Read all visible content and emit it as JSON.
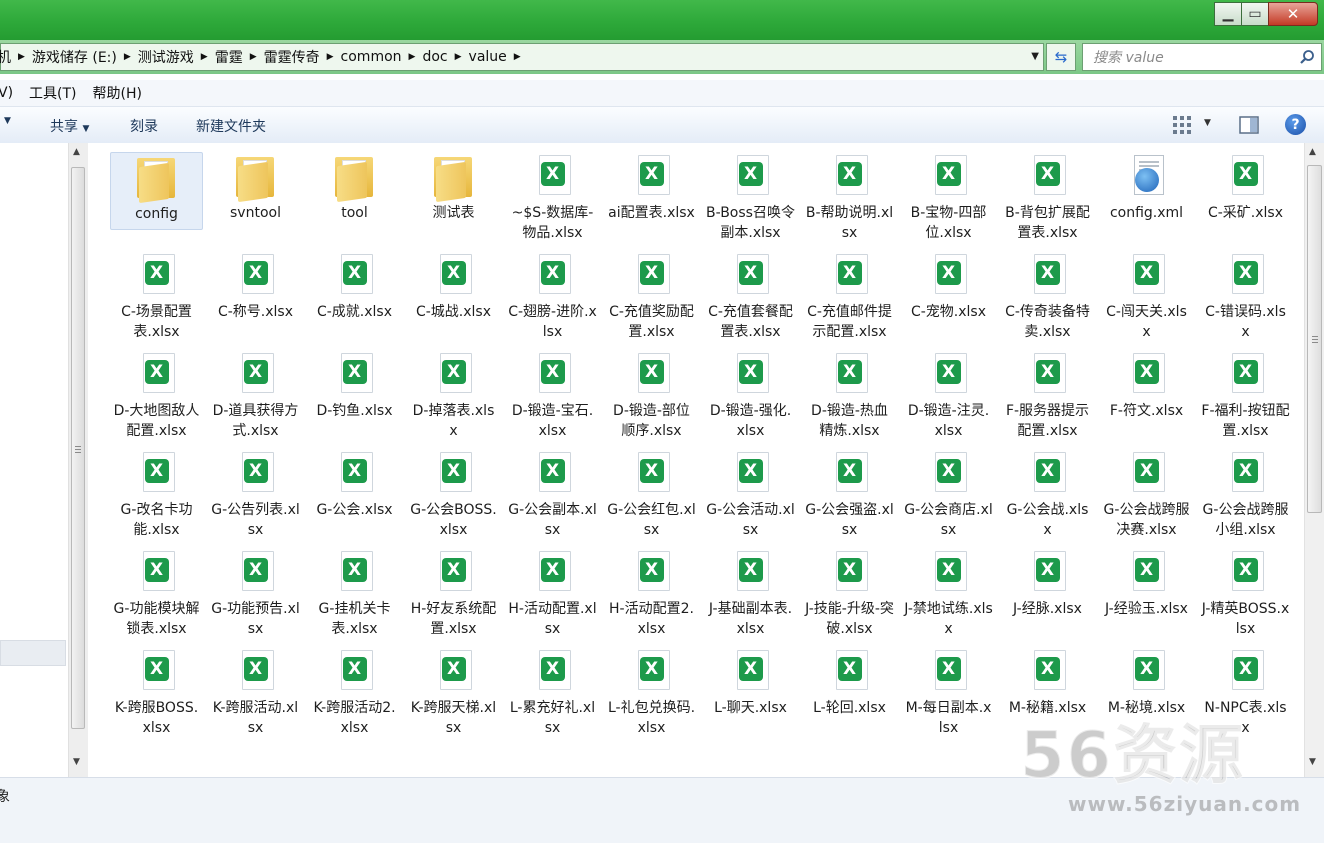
{
  "address": {
    "crumbs": [
      "机",
      "游戏储存 (E:)",
      "测试游戏",
      "雷霆",
      "雷霆传奇",
      "common",
      "doc",
      "value"
    ]
  },
  "search": {
    "placeholder": "搜索 value"
  },
  "menu": {
    "items": [
      "V)",
      "工具(T)",
      "帮助(H)"
    ]
  },
  "toolbar": {
    "share_label": "共享",
    "burn_label": "刻录",
    "new_folder_label": "新建文件夹"
  },
  "help": {
    "label": "?"
  },
  "files": [
    {
      "name": "config",
      "type": "folder"
    },
    {
      "name": "svntool",
      "type": "folder"
    },
    {
      "name": "tool",
      "type": "folder"
    },
    {
      "name": "测试表",
      "type": "folder"
    },
    {
      "name": "~$S-数据库-物品.xlsx",
      "type": "xlsx"
    },
    {
      "name": "ai配置表.xlsx",
      "type": "xlsx"
    },
    {
      "name": "B-Boss召唤令副本.xlsx",
      "type": "xlsx"
    },
    {
      "name": "B-帮助说明.xlsx",
      "type": "xlsx"
    },
    {
      "name": "B-宝物-四部位.xlsx",
      "type": "xlsx"
    },
    {
      "name": "B-背包扩展配置表.xlsx",
      "type": "xlsx"
    },
    {
      "name": "config.xml",
      "type": "xml"
    },
    {
      "name": "C-采矿.xlsx",
      "type": "xlsx"
    },
    {
      "name": "C-场景配置表.xlsx",
      "type": "xlsx"
    },
    {
      "name": "C-称号.xlsx",
      "type": "xlsx"
    },
    {
      "name": "C-成就.xlsx",
      "type": "xlsx"
    },
    {
      "name": "C-城战.xlsx",
      "type": "xlsx"
    },
    {
      "name": "C-翅膀-进阶.xlsx",
      "type": "xlsx"
    },
    {
      "name": "C-充值奖励配置.xlsx",
      "type": "xlsx"
    },
    {
      "name": "C-充值套餐配置表.xlsx",
      "type": "xlsx"
    },
    {
      "name": "C-充值邮件提示配置.xlsx",
      "type": "xlsx"
    },
    {
      "name": "C-宠物.xlsx",
      "type": "xlsx"
    },
    {
      "name": "C-传奇装备特卖.xlsx",
      "type": "xlsx"
    },
    {
      "name": "C-闯天关.xlsx",
      "type": "xlsx"
    },
    {
      "name": "C-错误码.xlsx",
      "type": "xlsx"
    },
    {
      "name": "D-大地图敌人配置.xlsx",
      "type": "xlsx"
    },
    {
      "name": "D-道具获得方式.xlsx",
      "type": "xlsx"
    },
    {
      "name": "D-钓鱼.xlsx",
      "type": "xlsx"
    },
    {
      "name": "D-掉落表.xlsx",
      "type": "xlsx"
    },
    {
      "name": "D-锻造-宝石.xlsx",
      "type": "xlsx"
    },
    {
      "name": "D-锻造-部位顺序.xlsx",
      "type": "xlsx"
    },
    {
      "name": "D-锻造-强化.xlsx",
      "type": "xlsx"
    },
    {
      "name": "D-锻造-热血精炼.xlsx",
      "type": "xlsx"
    },
    {
      "name": "D-锻造-注灵.xlsx",
      "type": "xlsx"
    },
    {
      "name": "F-服务器提示配置.xlsx",
      "type": "xlsx"
    },
    {
      "name": "F-符文.xlsx",
      "type": "xlsx"
    },
    {
      "name": "F-福利-按钮配置.xlsx",
      "type": "xlsx"
    },
    {
      "name": "G-改名卡功能.xlsx",
      "type": "xlsx"
    },
    {
      "name": "G-公告列表.xlsx",
      "type": "xlsx"
    },
    {
      "name": "G-公会.xlsx",
      "type": "xlsx"
    },
    {
      "name": "G-公会BOSS.xlsx",
      "type": "xlsx"
    },
    {
      "name": "G-公会副本.xlsx",
      "type": "xlsx"
    },
    {
      "name": "G-公会红包.xlsx",
      "type": "xlsx"
    },
    {
      "name": "G-公会活动.xlsx",
      "type": "xlsx"
    },
    {
      "name": "G-公会强盗.xlsx",
      "type": "xlsx"
    },
    {
      "name": "G-公会商店.xlsx",
      "type": "xlsx"
    },
    {
      "name": "G-公会战.xlsx",
      "type": "xlsx"
    },
    {
      "name": "G-公会战跨服决赛.xlsx",
      "type": "xlsx"
    },
    {
      "name": "G-公会战跨服小组.xlsx",
      "type": "xlsx"
    },
    {
      "name": "G-功能模块解锁表.xlsx",
      "type": "xlsx"
    },
    {
      "name": "G-功能预告.xlsx",
      "type": "xlsx"
    },
    {
      "name": "G-挂机关卡表.xlsx",
      "type": "xlsx"
    },
    {
      "name": "H-好友系统配置.xlsx",
      "type": "xlsx"
    },
    {
      "name": "H-活动配置.xlsx",
      "type": "xlsx"
    },
    {
      "name": "H-活动配置2.xlsx",
      "type": "xlsx"
    },
    {
      "name": "J-基础副本表.xlsx",
      "type": "xlsx"
    },
    {
      "name": "J-技能-升级-突破.xlsx",
      "type": "xlsx"
    },
    {
      "name": "J-禁地试练.xlsx",
      "type": "xlsx"
    },
    {
      "name": "J-经脉.xlsx",
      "type": "xlsx"
    },
    {
      "name": "J-经验玉.xlsx",
      "type": "xlsx"
    },
    {
      "name": "J-精英BOSS.xlsx",
      "type": "xlsx"
    },
    {
      "name": "K-跨服BOSS.xlsx",
      "type": "xlsx"
    },
    {
      "name": "K-跨服活动.xlsx",
      "type": "xlsx"
    },
    {
      "name": "K-跨服活动2.xlsx",
      "type": "xlsx"
    },
    {
      "name": "K-跨服天梯.xlsx",
      "type": "xlsx"
    },
    {
      "name": "L-累充好礼.xlsx",
      "type": "xlsx"
    },
    {
      "name": "L-礼包兑换码.xlsx",
      "type": "xlsx"
    },
    {
      "name": "L-聊天.xlsx",
      "type": "xlsx"
    },
    {
      "name": "L-轮回.xlsx",
      "type": "xlsx"
    },
    {
      "name": "M-每日副本.xlsx",
      "type": "xlsx"
    },
    {
      "name": "M-秘籍.xlsx",
      "type": "xlsx"
    },
    {
      "name": "M-秘境.xlsx",
      "type": "xlsx"
    },
    {
      "name": "N-NPC表.xlsx",
      "type": "xlsx"
    }
  ],
  "status": {
    "text": "象"
  },
  "watermark": {
    "big": "56资源",
    "url": "www.56ziyuan.com"
  }
}
